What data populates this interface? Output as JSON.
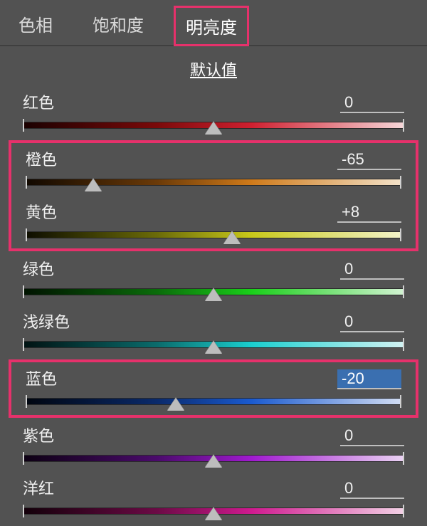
{
  "tabs": {
    "hue": "色相",
    "saturation": "饱和度",
    "luminance": "明亮度",
    "active": "luminance"
  },
  "default_label": "默认值",
  "sliders": {
    "red": {
      "label": "红色",
      "value": "0",
      "pos": 50
    },
    "orange": {
      "label": "橙色",
      "value": "-65",
      "pos": 18
    },
    "yellow": {
      "label": "黄色",
      "value": "+8",
      "pos": 55
    },
    "green": {
      "label": "绿色",
      "value": "0",
      "pos": 50
    },
    "aqua": {
      "label": "浅绿色",
      "value": "0",
      "pos": 50
    },
    "blue": {
      "label": "蓝色",
      "value": "-20",
      "pos": 40
    },
    "purple": {
      "label": "紫色",
      "value": "0",
      "pos": 50
    },
    "magenta": {
      "label": "洋红",
      "value": "0",
      "pos": 50
    }
  },
  "highlights": {
    "tab_luminance": true,
    "group_orange_yellow": true,
    "group_blue": true
  },
  "colors": {
    "highlight": "#e6316b",
    "panel_bg": "#525252"
  }
}
